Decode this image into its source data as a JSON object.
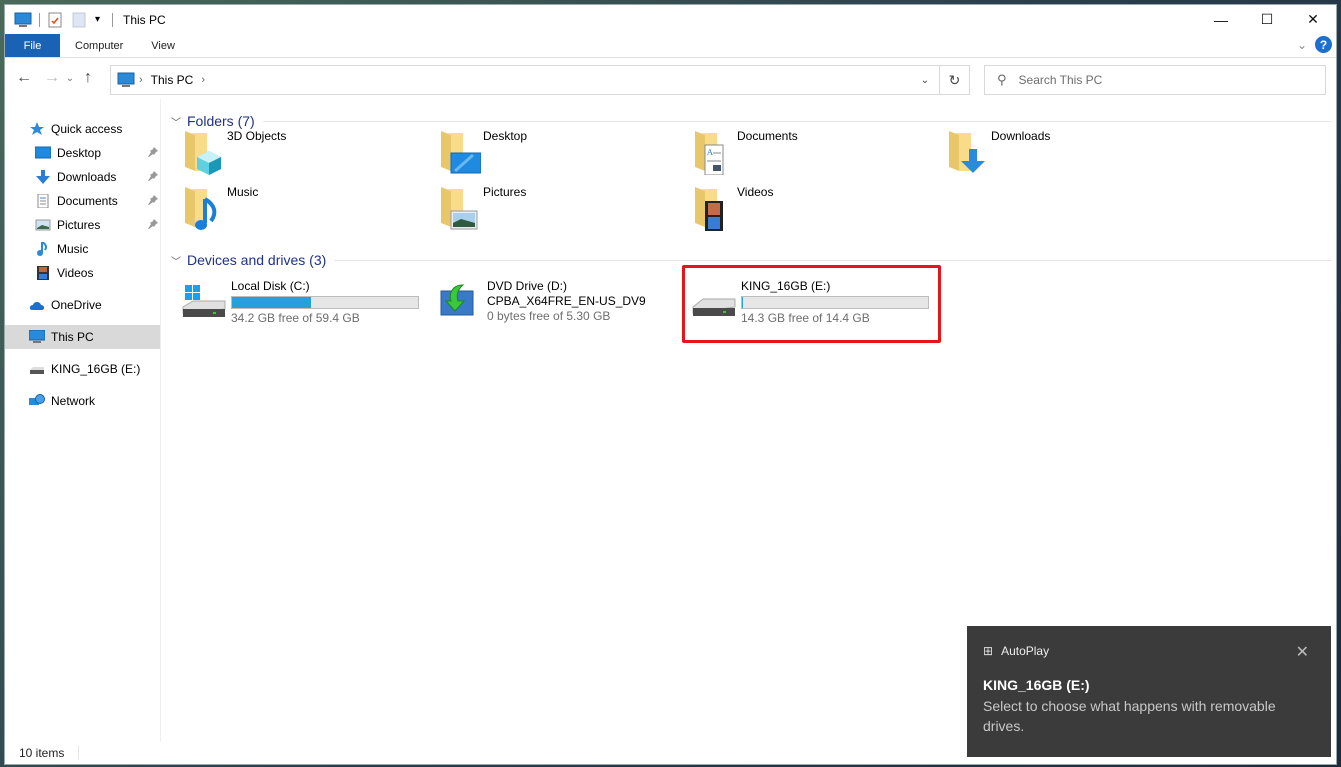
{
  "window": {
    "title": "This PC",
    "controls": {
      "minimize": "—",
      "maximize": "☐",
      "close": "✕"
    }
  },
  "ribbon": {
    "tabs": [
      {
        "label": "File"
      },
      {
        "label": "Computer"
      },
      {
        "label": "View"
      }
    ],
    "expand_icon": "⌄",
    "help_label": "?"
  },
  "navbar": {
    "back": "←",
    "forward": "→",
    "recent": "⌄",
    "up": "↑",
    "breadcrumb": [
      "This PC"
    ],
    "chevron": "›",
    "dropdown": "⌄",
    "refresh": "↻",
    "search_placeholder": "Search This PC"
  },
  "sidebar": {
    "items": [
      {
        "label": "Quick access",
        "icon": "star-icon",
        "level": 0
      },
      {
        "label": "Desktop",
        "icon": "desktop-icon",
        "level": 1,
        "pinned": true
      },
      {
        "label": "Downloads",
        "icon": "download-icon",
        "level": 1,
        "pinned": true
      },
      {
        "label": "Documents",
        "icon": "documents-icon",
        "level": 1,
        "pinned": true
      },
      {
        "label": "Pictures",
        "icon": "pictures-icon",
        "level": 1,
        "pinned": true
      },
      {
        "label": "Music",
        "icon": "music-icon",
        "level": 1
      },
      {
        "label": "Videos",
        "icon": "videos-icon",
        "level": 1
      },
      {
        "label": "OneDrive",
        "icon": "cloud-icon",
        "level": 0
      },
      {
        "label": "This PC",
        "icon": "computer-icon",
        "level": 0,
        "selected": true
      },
      {
        "label": "KING_16GB (E:)",
        "icon": "usb-drive-icon",
        "level": 0
      },
      {
        "label": "Network",
        "icon": "network-icon",
        "level": 0
      }
    ],
    "pin_glyph": "📌"
  },
  "main": {
    "folders_header": "Folders (7)",
    "folders": [
      {
        "name": "3D Objects",
        "overlay": "cube"
      },
      {
        "name": "Desktop",
        "overlay": "desktop"
      },
      {
        "name": "Documents",
        "overlay": "document"
      },
      {
        "name": "Downloads",
        "overlay": "download"
      },
      {
        "name": "Music",
        "overlay": "music"
      },
      {
        "name": "Pictures",
        "overlay": "picture"
      },
      {
        "name": "Videos",
        "overlay": "video"
      }
    ],
    "drives_header": "Devices and drives (3)",
    "drives": [
      {
        "name": "Local Disk (C:)",
        "free": "34.2 GB free of 59.4 GB",
        "used_fraction": 0.424,
        "type": "system"
      },
      {
        "name": "DVD Drive (D:)",
        "label": "CPBA_X64FRE_EN-US_DV9",
        "free": "0 bytes free of 5.30 GB",
        "type": "dvd"
      },
      {
        "name": "KING_16GB (E:)",
        "free": "14.3 GB free of 14.4 GB",
        "used_fraction": 0.007,
        "type": "usb",
        "highlighted": true
      }
    ]
  },
  "status": {
    "items_count": "10 items"
  },
  "toast": {
    "app": "AutoPlay",
    "app_icon": "⊞",
    "close": "✕",
    "title": "KING_16GB (E:)",
    "body": "Select to choose what happens with removable drives."
  },
  "colors": {
    "accent": "#1a63b4",
    "highlight": "#e8141c",
    "drive_bar": "#26a0da",
    "toast_bg": "#3b3b3b"
  }
}
